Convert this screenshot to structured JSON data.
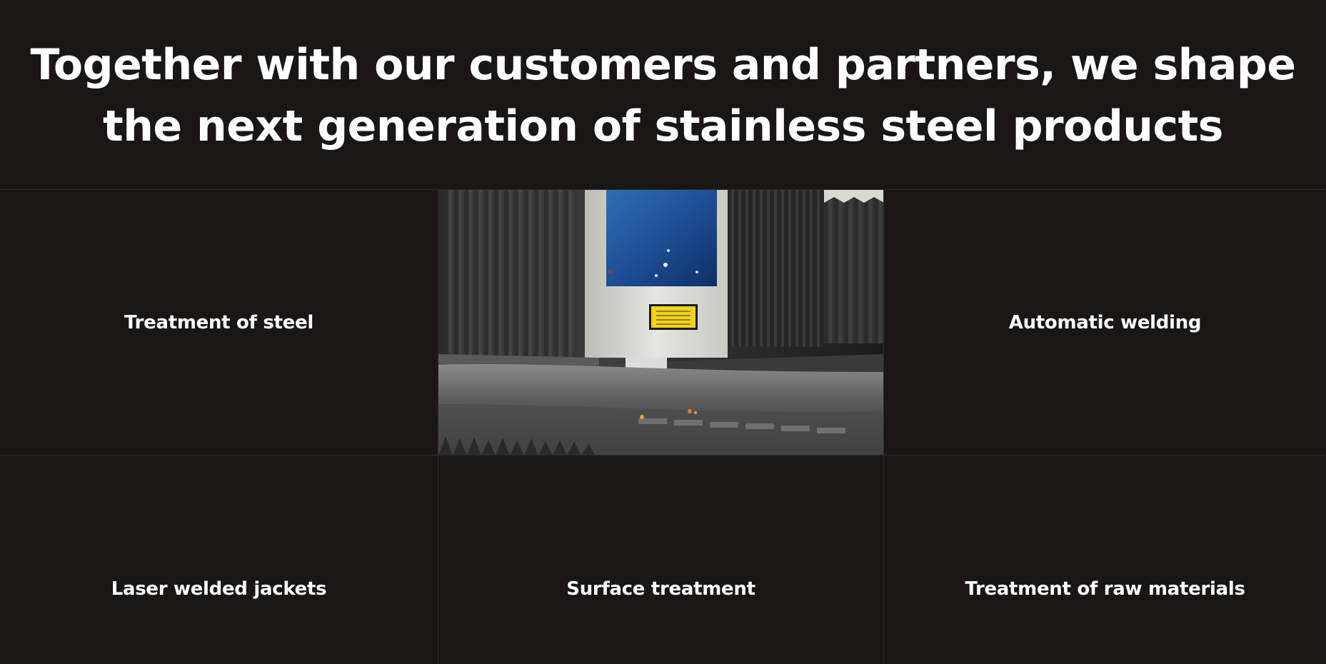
{
  "hero": {
    "heading": "Together with our customers and partners, we shape the next generation of stainless steel products"
  },
  "services": {
    "items": [
      {
        "label": "Treatment of steel"
      },
      {
        "label": "Automatic welding"
      },
      {
        "label": "Laser welded jackets"
      },
      {
        "label": "Surface treatment"
      },
      {
        "label": "Treatment of raw materials"
      }
    ],
    "photo_icon": "laser-cutting-machine-photo"
  },
  "colors": {
    "background": "#181716",
    "grid_line": "#2d2c2a",
    "text": "#ffffff"
  }
}
